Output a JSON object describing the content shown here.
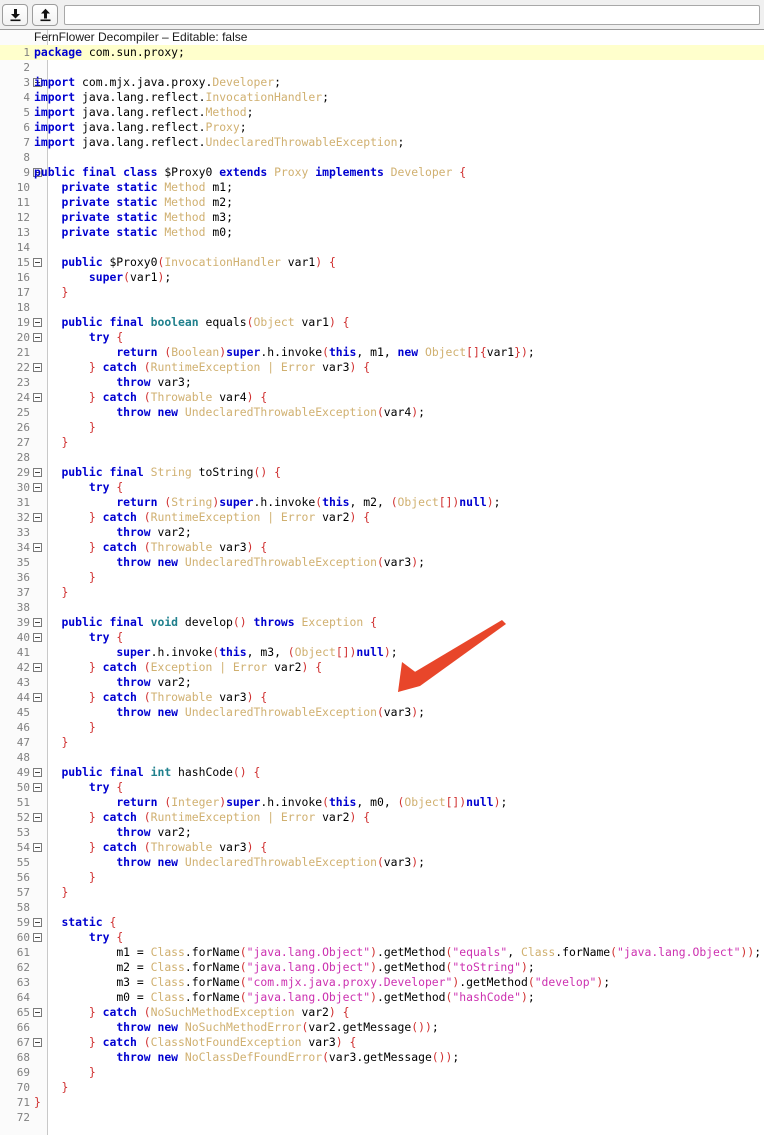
{
  "window": {
    "title": "FernFlower Decompiler",
    "editable_label": "FernFlower Decompiler – Editable: false"
  },
  "toolbar": {
    "download_button": {
      "label": "Download",
      "icon": "download-icon"
    },
    "upload_button": {
      "label": "Upload",
      "icon": "upload-icon"
    },
    "search_field": {
      "value": "",
      "placeholder": ""
    }
  },
  "editor": {
    "header_text": "FernFlower Decompiler – Editable: false",
    "current_line": 1,
    "total_lines": 72,
    "language": "java",
    "colors": {
      "keyword": "#0000d0",
      "primitive_type": "#20808d",
      "class_type": "#d0b070",
      "string_literal": "#cc31b0",
      "bracket": "#d03030",
      "plain": "#000000",
      "line_number": "#808080",
      "current_line_highlight": "#ffffcc",
      "gutter_background": "#fbfbfb",
      "editor_background": "#ffffff"
    },
    "lines": [
      {
        "n": 1,
        "fold": false,
        "t": "package com.sun.proxy;"
      },
      {
        "n": 2,
        "fold": false,
        "t": ""
      },
      {
        "n": 3,
        "fold": true,
        "t": "import com.mjx.java.proxy.Developer;"
      },
      {
        "n": 4,
        "fold": false,
        "t": "import java.lang.reflect.InvocationHandler;"
      },
      {
        "n": 5,
        "fold": false,
        "t": "import java.lang.reflect.Method;"
      },
      {
        "n": 6,
        "fold": false,
        "t": "import java.lang.reflect.Proxy;"
      },
      {
        "n": 7,
        "fold": false,
        "t": "import java.lang.reflect.UndeclaredThrowableException;"
      },
      {
        "n": 8,
        "fold": false,
        "t": ""
      },
      {
        "n": 9,
        "fold": true,
        "t": "public final class $Proxy0 extends Proxy implements Developer {"
      },
      {
        "n": 10,
        "fold": false,
        "t": "    private static Method m1;"
      },
      {
        "n": 11,
        "fold": false,
        "t": "    private static Method m2;"
      },
      {
        "n": 12,
        "fold": false,
        "t": "    private static Method m3;"
      },
      {
        "n": 13,
        "fold": false,
        "t": "    private static Method m0;"
      },
      {
        "n": 14,
        "fold": false,
        "t": ""
      },
      {
        "n": 15,
        "fold": true,
        "t": "    public $Proxy0(InvocationHandler var1) {"
      },
      {
        "n": 16,
        "fold": false,
        "t": "        super(var1);"
      },
      {
        "n": 17,
        "fold": false,
        "t": "    }"
      },
      {
        "n": 18,
        "fold": false,
        "t": ""
      },
      {
        "n": 19,
        "fold": true,
        "t": "    public final boolean equals(Object var1) {"
      },
      {
        "n": 20,
        "fold": true,
        "t": "        try {"
      },
      {
        "n": 21,
        "fold": false,
        "t": "            return (Boolean)super.h.invoke(this, m1, new Object[]{var1});"
      },
      {
        "n": 22,
        "fold": true,
        "t": "        } catch (RuntimeException | Error var3) {"
      },
      {
        "n": 23,
        "fold": false,
        "t": "            throw var3;"
      },
      {
        "n": 24,
        "fold": true,
        "t": "        } catch (Throwable var4) {"
      },
      {
        "n": 25,
        "fold": false,
        "t": "            throw new UndeclaredThrowableException(var4);"
      },
      {
        "n": 26,
        "fold": false,
        "t": "        }"
      },
      {
        "n": 27,
        "fold": false,
        "t": "    }"
      },
      {
        "n": 28,
        "fold": false,
        "t": ""
      },
      {
        "n": 29,
        "fold": true,
        "t": "    public final String toString() {"
      },
      {
        "n": 30,
        "fold": true,
        "t": "        try {"
      },
      {
        "n": 31,
        "fold": false,
        "t": "            return (String)super.h.invoke(this, m2, (Object[])null);"
      },
      {
        "n": 32,
        "fold": true,
        "t": "        } catch (RuntimeException | Error var2) {"
      },
      {
        "n": 33,
        "fold": false,
        "t": "            throw var2;"
      },
      {
        "n": 34,
        "fold": true,
        "t": "        } catch (Throwable var3) {"
      },
      {
        "n": 35,
        "fold": false,
        "t": "            throw new UndeclaredThrowableException(var3);"
      },
      {
        "n": 36,
        "fold": false,
        "t": "        }"
      },
      {
        "n": 37,
        "fold": false,
        "t": "    }"
      },
      {
        "n": 38,
        "fold": false,
        "t": ""
      },
      {
        "n": 39,
        "fold": true,
        "t": "    public final void develop() throws Exception {"
      },
      {
        "n": 40,
        "fold": true,
        "t": "        try {"
      },
      {
        "n": 41,
        "fold": false,
        "t": "            super.h.invoke(this, m3, (Object[])null);"
      },
      {
        "n": 42,
        "fold": true,
        "t": "        } catch (Exception | Error var2) {"
      },
      {
        "n": 43,
        "fold": false,
        "t": "            throw var2;"
      },
      {
        "n": 44,
        "fold": true,
        "t": "        } catch (Throwable var3) {"
      },
      {
        "n": 45,
        "fold": false,
        "t": "            throw new UndeclaredThrowableException(var3);"
      },
      {
        "n": 46,
        "fold": false,
        "t": "        }"
      },
      {
        "n": 47,
        "fold": false,
        "t": "    }"
      },
      {
        "n": 48,
        "fold": false,
        "t": ""
      },
      {
        "n": 49,
        "fold": true,
        "t": "    public final int hashCode() {"
      },
      {
        "n": 50,
        "fold": true,
        "t": "        try {"
      },
      {
        "n": 51,
        "fold": false,
        "t": "            return (Integer)super.h.invoke(this, m0, (Object[])null);"
      },
      {
        "n": 52,
        "fold": true,
        "t": "        } catch (RuntimeException | Error var2) {"
      },
      {
        "n": 53,
        "fold": false,
        "t": "            throw var2;"
      },
      {
        "n": 54,
        "fold": true,
        "t": "        } catch (Throwable var3) {"
      },
      {
        "n": 55,
        "fold": false,
        "t": "            throw new UndeclaredThrowableException(var3);"
      },
      {
        "n": 56,
        "fold": false,
        "t": "        }"
      },
      {
        "n": 57,
        "fold": false,
        "t": "    }"
      },
      {
        "n": 58,
        "fold": false,
        "t": ""
      },
      {
        "n": 59,
        "fold": true,
        "t": "    static {"
      },
      {
        "n": 60,
        "fold": true,
        "t": "        try {"
      },
      {
        "n": 61,
        "fold": false,
        "t": "            m1 = Class.forName(\"java.lang.Object\").getMethod(\"equals\", Class.forName(\"java.lang.Object\"));"
      },
      {
        "n": 62,
        "fold": false,
        "t": "            m2 = Class.forName(\"java.lang.Object\").getMethod(\"toString\");"
      },
      {
        "n": 63,
        "fold": false,
        "t": "            m3 = Class.forName(\"com.mjx.java.proxy.Developer\").getMethod(\"develop\");"
      },
      {
        "n": 64,
        "fold": false,
        "t": "            m0 = Class.forName(\"java.lang.Object\").getMethod(\"hashCode\");"
      },
      {
        "n": 65,
        "fold": true,
        "t": "        } catch (NoSuchMethodException var2) {"
      },
      {
        "n": 66,
        "fold": false,
        "t": "            throw new NoSuchMethodError(var2.getMessage());"
      },
      {
        "n": 67,
        "fold": true,
        "t": "        } catch (ClassNotFoundException var3) {"
      },
      {
        "n": 68,
        "fold": false,
        "t": "            throw new NoClassDefFoundError(var3.getMessage());"
      },
      {
        "n": 69,
        "fold": false,
        "t": "        }"
      },
      {
        "n": 70,
        "fold": false,
        "t": "    }"
      },
      {
        "n": 71,
        "fold": false,
        "t": "}"
      },
      {
        "n": 72,
        "fold": false,
        "t": ""
      }
    ]
  },
  "annotation": {
    "arrow": {
      "color": "#e8462a",
      "points_at_line": 41,
      "description": "red arrow pointing at super.h.invoke(this, m3, (Object[])null);"
    }
  }
}
